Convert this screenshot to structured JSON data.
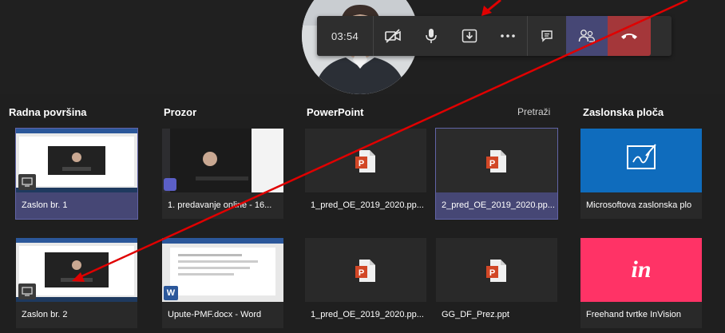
{
  "call": {
    "timer": "03:54",
    "icons": {
      "camera": "camera-off-icon",
      "mic": "microphone-icon",
      "share": "share-tray-icon",
      "more": "more-options-icon",
      "chat": "chat-icon",
      "participants": "participants-icon",
      "hangup": "hang-up-icon"
    },
    "colors": {
      "participants_bg": "#464775",
      "hangup_bg": "#a4373a"
    }
  },
  "tray": {
    "columns": {
      "desktop": "Radna površina",
      "window": "Prozor",
      "powerpoint": "PowerPoint",
      "whiteboard": "Zaslonska ploča"
    },
    "search": "Pretraži",
    "desktop_tiles": [
      {
        "caption": "Zaslon br. 1",
        "selected": true
      },
      {
        "caption": "Zaslon br. 2",
        "selected": false
      }
    ],
    "window_tiles": [
      {
        "caption": "1. predavanje online - 16..."
      },
      {
        "caption": "Upute-PMF.docx - Word",
        "app_badge": "W"
      }
    ],
    "ppt_tiles": [
      {
        "caption": "1_pred_OE_2019_2020.pp...",
        "selected": false
      },
      {
        "caption": "2_pred_OE_2019_2020.pp...",
        "selected": true
      },
      {
        "caption": "1_pred_OE_2019_2020.pp...",
        "selected": false
      },
      {
        "caption": "GG_DF_Prez.ppt",
        "selected": false
      }
    ],
    "board_tiles": [
      {
        "caption": "Microsoftova zaslonska plo"
      },
      {
        "caption": "Freehand tvrtke InVision",
        "logo_text": "in"
      }
    ],
    "colors": {
      "whiteboard": "#0f6cbd",
      "invision": "#ff3366",
      "selected": "#6264a7",
      "annotation_arrow": "#e00000"
    }
  }
}
